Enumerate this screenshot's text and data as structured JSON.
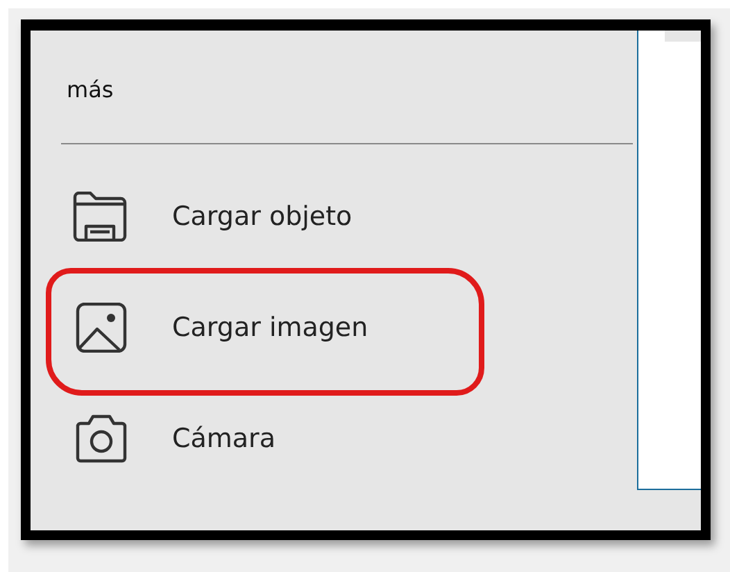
{
  "menu": {
    "heading": "más",
    "items": [
      {
        "kind": "folder",
        "label": "Cargar objeto",
        "highlighted": false
      },
      {
        "kind": "image",
        "label": "Cargar imagen",
        "highlighted": true
      },
      {
        "kind": "camera",
        "label": "Cámara",
        "highlighted": false
      }
    ]
  }
}
